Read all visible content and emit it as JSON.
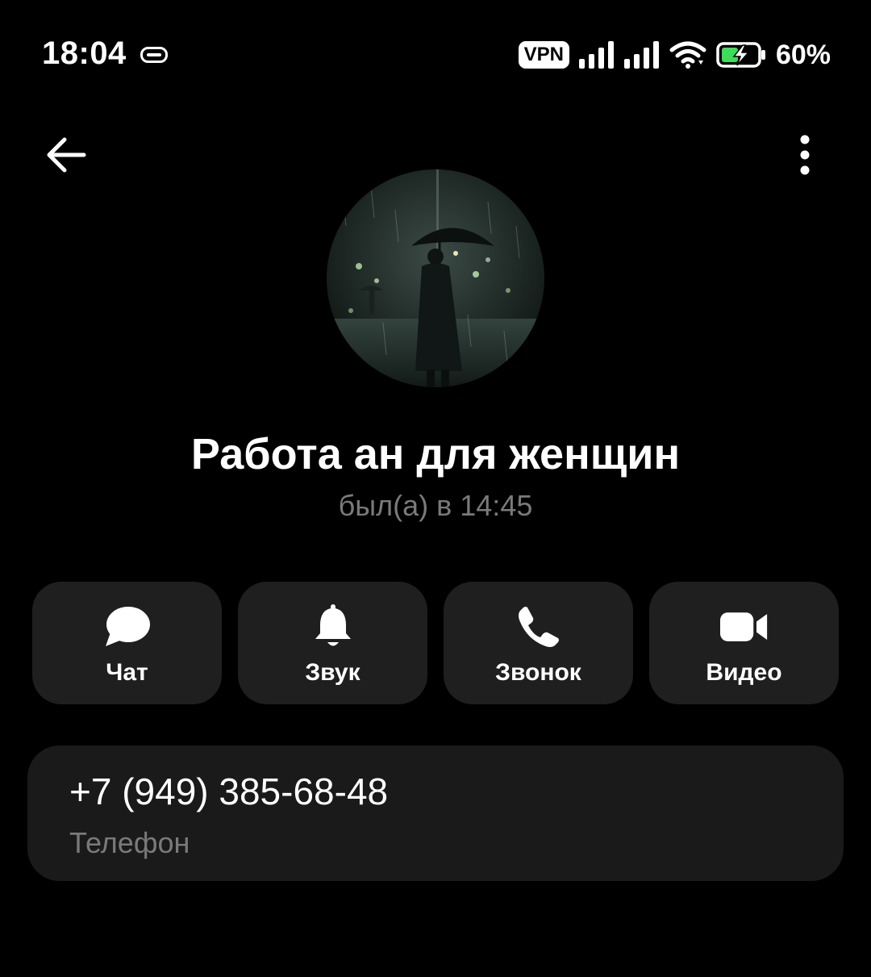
{
  "status_bar": {
    "time": "18:04",
    "vpn": "VPN",
    "battery": "60%",
    "icons": [
      "keyboard-icon",
      "vpn-badge",
      "signal-icon",
      "signal-icon",
      "wifi-icon",
      "battery-charging-icon"
    ]
  },
  "app_bar": {
    "back_icon": "arrow-left-icon",
    "menu_icon": "more-vertical-icon"
  },
  "profile": {
    "name": "Работа ан для женщин",
    "last_seen": "был(а) в 14:45"
  },
  "actions": [
    {
      "label": "Чат",
      "icon": "chat-bubble-icon"
    },
    {
      "label": "Звук",
      "icon": "bell-icon"
    },
    {
      "label": "Звонок",
      "icon": "phone-icon"
    },
    {
      "label": "Видео",
      "icon": "video-camera-icon"
    }
  ],
  "contact": {
    "phone": "+7 (949) 385-68-48",
    "phone_label": "Телефон"
  },
  "colors": {
    "background": "#000000",
    "button_bg": "#1f1f1f",
    "card_bg": "#1a1a1a",
    "muted_text": "#7a7a7a",
    "battery_green": "#3ddc5a"
  }
}
